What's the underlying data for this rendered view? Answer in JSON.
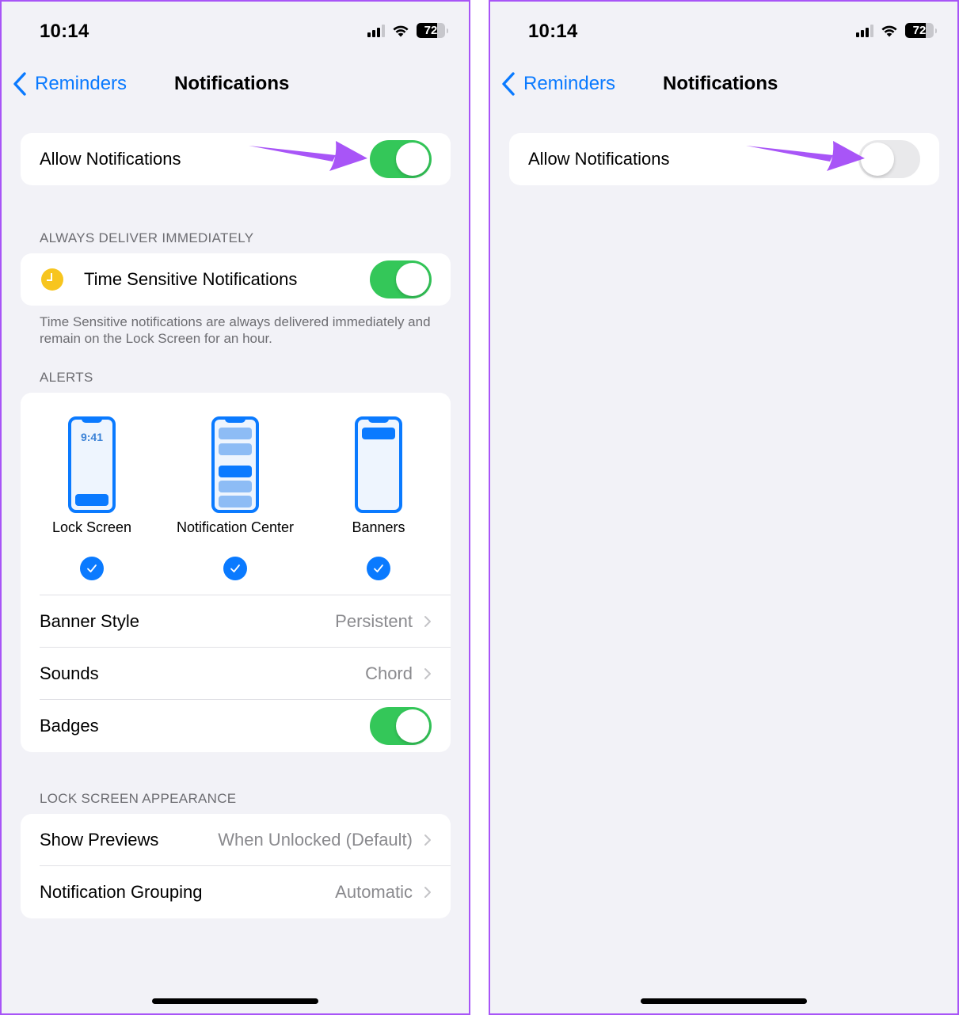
{
  "colors": {
    "accent": "#0a7aff",
    "toggle_on": "#34c759",
    "toggle_off": "#e9e9eb",
    "annotation_arrow": "#a855f7",
    "panel_border": "#a855f7",
    "clock_icon": "#f7c51e"
  },
  "left": {
    "status": {
      "time": "10:14",
      "battery": "72",
      "battery_level_percent": 72,
      "signal_bars": 3,
      "signal_max": 4,
      "wifi": "wifi-icon"
    },
    "nav": {
      "back_label": "Reminders",
      "title": "Notifications"
    },
    "allow_notifications": {
      "label": "Allow Notifications",
      "on": true
    },
    "always_deliver": {
      "header": "ALWAYS DELIVER IMMEDIATELY",
      "time_sensitive": {
        "label": "Time Sensitive Notifications",
        "icon": "clock-icon",
        "on": true
      },
      "footer": "Time Sensitive notifications are always delivered immediately and remain on the Lock Screen for an hour."
    },
    "alerts": {
      "header": "ALERTS",
      "options": [
        {
          "label": "Lock Screen",
          "preview_time": "9:41",
          "checked": true
        },
        {
          "label": "Notification Center",
          "checked": true
        },
        {
          "label": "Banners",
          "checked": true
        }
      ],
      "rows": [
        {
          "label": "Banner Style",
          "value": "Persistent"
        },
        {
          "label": "Sounds",
          "value": "Chord"
        }
      ],
      "badges": {
        "label": "Badges",
        "on": true
      }
    },
    "lock_screen_appearance": {
      "header": "LOCK SCREEN APPEARANCE",
      "rows": [
        {
          "label": "Show Previews",
          "value": "When Unlocked (Default)"
        },
        {
          "label": "Notification Grouping",
          "value": "Automatic"
        }
      ]
    }
  },
  "right": {
    "status": {
      "time": "10:14",
      "battery": "72",
      "battery_level_percent": 72,
      "signal_bars": 3,
      "signal_max": 4,
      "wifi": "wifi-icon"
    },
    "nav": {
      "back_label": "Reminders",
      "title": "Notifications"
    },
    "allow_notifications": {
      "label": "Allow Notifications",
      "on": false
    }
  }
}
